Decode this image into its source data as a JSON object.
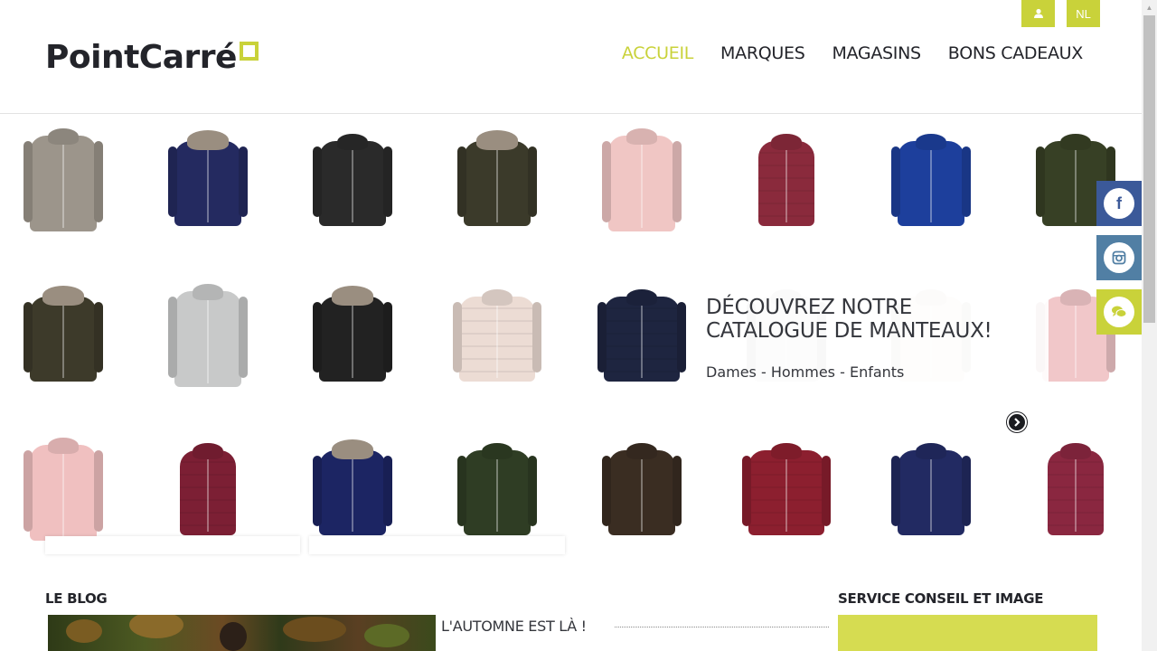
{
  "header": {
    "logo_text": "PointCarré",
    "user_icon": "user-icon",
    "lang_button": "NL",
    "nav": [
      {
        "label": "ACCUEIL",
        "active": true
      },
      {
        "label": "MARQUES",
        "active": false
      },
      {
        "label": "MAGASINS",
        "active": false
      },
      {
        "label": "BONS CADEAUX",
        "active": false
      }
    ]
  },
  "hero": {
    "title": "DÉCOUVREZ NOTRE CATALOGUE DE MANTEAUX!",
    "subtitle": "Dames - Hommes - Enfants",
    "next_icon": "chevron-right-icon",
    "products": [
      {
        "color": "#9c958b",
        "style": "long"
      },
      {
        "color": "#242a60",
        "style": "fur"
      },
      {
        "color": "#2a2a2a",
        "style": "hood"
      },
      {
        "color": "#3b3a2a",
        "style": "fur"
      },
      {
        "color": "#f0c6c4",
        "style": "long"
      },
      {
        "color": "#8a2a3c",
        "style": "vest"
      },
      {
        "color": "#1d3f9c",
        "style": "hood"
      },
      {
        "color": "#374025",
        "style": "hood"
      },
      {
        "color": "#3d3a2a",
        "style": "fur"
      },
      {
        "color": "#c8c9c9",
        "style": "long"
      },
      {
        "color": "#222222",
        "style": "fur"
      },
      {
        "color": "#ecdcd4",
        "style": "puffer"
      },
      {
        "color": "#1e2540",
        "style": "puffer"
      },
      {
        "color": "#dcdcdc",
        "style": "hood"
      },
      {
        "color": "#f2ebe2",
        "style": "hood"
      },
      {
        "color": "#f1c7c9",
        "style": "hood"
      },
      {
        "color": "#f0c0c0",
        "style": "long"
      },
      {
        "color": "#7c1f34",
        "style": "vest"
      },
      {
        "color": "#1c2563",
        "style": "fur"
      },
      {
        "color": "#2f3d24",
        "style": "hood"
      },
      {
        "color": "#3a2d22",
        "style": "hood"
      },
      {
        "color": "#8c1f2f",
        "style": "puffer"
      },
      {
        "color": "#222a62",
        "style": "hood"
      },
      {
        "color": "#8a2740",
        "style": "vest"
      }
    ]
  },
  "social": {
    "facebook_icon": "f",
    "instagram_icon": "instagram-icon",
    "chat_icon": "chat-icon"
  },
  "blog": {
    "title": "LE BLOG",
    "post_title": "L'AUTOMNE EST LÀ !"
  },
  "service": {
    "title": "SERVICE CONSEIL ET IMAGE"
  },
  "colors": {
    "accent": "#c9d23a",
    "text": "#23242a",
    "facebook": "#3b5999",
    "instagram": "#517fa4"
  }
}
